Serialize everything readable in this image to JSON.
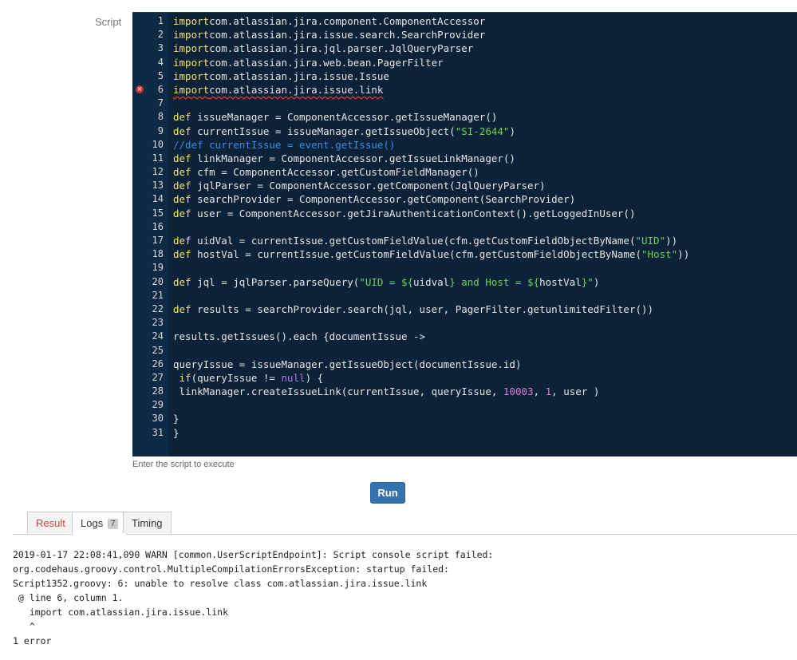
{
  "form": {
    "script_label": "Script",
    "hint": "Enter the script to execute",
    "run_label": "Run"
  },
  "editor": {
    "error_line": 6,
    "lines": [
      {
        "n": "1",
        "tokens": [
          [
            "kw",
            "import"
          ],
          [
            "",
            "com.atlassian.jira.component.ComponentAccessor"
          ]
        ]
      },
      {
        "n": "2",
        "tokens": [
          [
            "kw",
            "import"
          ],
          [
            "",
            "com.atlassian.jira.issue.search.SearchProvider"
          ]
        ]
      },
      {
        "n": "3",
        "tokens": [
          [
            "kw",
            "import"
          ],
          [
            "",
            "com.atlassian.jira.jql.parser.JqlQueryParser"
          ]
        ]
      },
      {
        "n": "4",
        "tokens": [
          [
            "kw",
            "import"
          ],
          [
            "",
            "com.atlassian.jira.web.bean.PagerFilter"
          ]
        ]
      },
      {
        "n": "5",
        "tokens": [
          [
            "kw",
            "import"
          ],
          [
            "",
            "com.atlassian.jira.issue.Issue"
          ]
        ]
      },
      {
        "n": "6",
        "tokens": [
          [
            "kw",
            "import"
          ],
          [
            "",
            "com.atlassian.jira.issue.link"
          ]
        ]
      },
      {
        "n": "7",
        "tokens": []
      },
      {
        "n": "8",
        "tokens": [
          [
            "kw",
            "def"
          ],
          [
            "",
            " issueManager = ComponentAccessor.getIssueManager()"
          ]
        ]
      },
      {
        "n": "9",
        "tokens": [
          [
            "kw",
            "def"
          ],
          [
            "",
            " currentIssue = issueManager.getIssueObject("
          ],
          [
            "str",
            "\"SI-2644\""
          ],
          [
            "",
            ")"
          ]
        ]
      },
      {
        "n": "10",
        "tokens": [
          [
            "cmt",
            "//def currentIssue = event.getIssue()"
          ]
        ]
      },
      {
        "n": "11",
        "tokens": [
          [
            "kw",
            "def"
          ],
          [
            "",
            " linkManager = ComponentAccessor.getIssueLinkManager()"
          ]
        ]
      },
      {
        "n": "12",
        "tokens": [
          [
            "kw",
            "def"
          ],
          [
            "",
            " cfm = ComponentAccessor.getCustomFieldManager()"
          ]
        ]
      },
      {
        "n": "13",
        "tokens": [
          [
            "kw",
            "def"
          ],
          [
            "",
            " jqlParser = ComponentAccessor.getComponent(JqlQueryParser)"
          ]
        ]
      },
      {
        "n": "14",
        "tokens": [
          [
            "kw",
            "def"
          ],
          [
            "",
            " searchProvider = ComponentAccessor.getComponent(SearchProvider)"
          ]
        ]
      },
      {
        "n": "15",
        "tokens": [
          [
            "kw",
            "def"
          ],
          [
            "",
            " user = ComponentAccessor.getJiraAuthenticationContext().getLoggedInUser()"
          ]
        ]
      },
      {
        "n": "16",
        "tokens": []
      },
      {
        "n": "17",
        "tokens": [
          [
            "kw",
            "def"
          ],
          [
            "",
            " uidVal = currentIssue.getCustomFieldValue(cfm.getCustomFieldObjectByName("
          ],
          [
            "str",
            "\"UID\""
          ],
          [
            "",
            "))"
          ]
        ]
      },
      {
        "n": "18",
        "tokens": [
          [
            "kw",
            "def"
          ],
          [
            "",
            " hostVal = currentIssue.getCustomFieldValue(cfm.getCustomFieldObjectByName("
          ],
          [
            "str",
            "\"Host\""
          ],
          [
            "",
            "))"
          ]
        ]
      },
      {
        "n": "19",
        "tokens": []
      },
      {
        "n": "20",
        "tokens": [
          [
            "kw",
            "def"
          ],
          [
            "",
            " jql = jqlParser.parseQuery("
          ],
          [
            "str",
            "\"UID = ${"
          ],
          [
            "",
            "uidval"
          ],
          [
            "str",
            "} and Host = ${"
          ],
          [
            "",
            "hostVal"
          ],
          [
            "str",
            "}\""
          ],
          [
            "",
            ")"
          ]
        ]
      },
      {
        "n": "21",
        "tokens": []
      },
      {
        "n": "22",
        "tokens": [
          [
            "kw",
            "def"
          ],
          [
            "",
            " results = searchProvider.search(jql, user, PagerFilter.getunlimitedFilter())"
          ]
        ]
      },
      {
        "n": "23",
        "tokens": []
      },
      {
        "n": "24",
        "tokens": [
          [
            "",
            "results.getIssues().each {documentIssue ->"
          ]
        ]
      },
      {
        "n": "25",
        "tokens": []
      },
      {
        "n": "26",
        "tokens": [
          [
            "",
            "queryIssue = issueManager.getIssueObject(documentIssue.id)"
          ]
        ]
      },
      {
        "n": "27",
        "tokens": [
          [
            "",
            " "
          ],
          [
            "kw",
            "if"
          ],
          [
            "",
            "(queryIssue != "
          ],
          [
            "nul",
            "null"
          ],
          [
            "",
            ") {"
          ]
        ]
      },
      {
        "n": "28",
        "tokens": [
          [
            "",
            " linkManager.createIssueLink(currentIssue, queryIssue, "
          ],
          [
            "num",
            "10003"
          ],
          [
            "",
            ", "
          ],
          [
            "num",
            "1"
          ],
          [
            "",
            ", user )"
          ]
        ]
      },
      {
        "n": "29",
        "tokens": []
      },
      {
        "n": "30",
        "tokens": [
          [
            "",
            "}"
          ]
        ]
      },
      {
        "n": "31",
        "tokens": [
          [
            "",
            "}"
          ]
        ]
      }
    ]
  },
  "tabs": [
    {
      "key": "result",
      "label": "Result",
      "badge": ""
    },
    {
      "key": "logs",
      "label": "Logs",
      "badge": "7"
    },
    {
      "key": "timing",
      "label": "Timing",
      "badge": ""
    }
  ],
  "log": {
    "lines": [
      "2019-01-17 22:08:41,090 WARN [common.UserScriptEndpoint]: Script console script failed:",
      "org.codehaus.groovy.control.MultipleCompilationErrorsException: startup failed:",
      "Script1352.groovy: 6: unable to resolve class com.atlassian.jira.issue.link",
      " @ line 6, column 1.",
      "   import com.atlassian.jira.issue.link",
      "   ^",
      "1 error"
    ]
  }
}
